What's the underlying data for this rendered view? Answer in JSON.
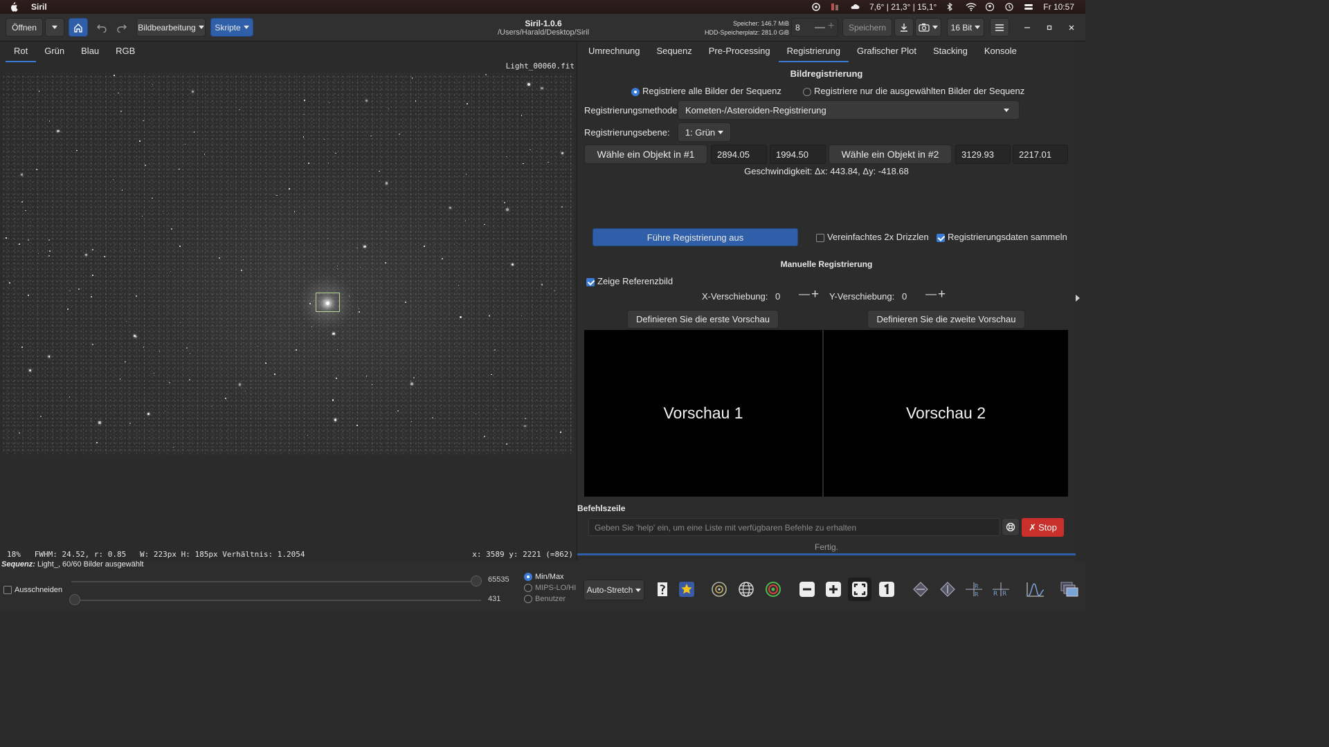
{
  "menubar": {
    "app_name": "Siril",
    "weather": "7,6° | 21,3° | 15,1°",
    "clock": "Fr 10:57"
  },
  "header": {
    "open_label": "Öffnen",
    "image_processing_label": "Bildbearbeitung",
    "scripts_label": "Skripte",
    "title": "Siril-1.0.6",
    "path": "/Users/Harald/Desktop/Siril",
    "memory": "Speicher: 146.7 MiB",
    "disk": "HDD-Speicherplatz: 281.0 GiB",
    "threads": "8",
    "save_label": "Speichern",
    "bitdepth": "16 Bit"
  },
  "left": {
    "tabs": [
      "Rot",
      "Grün",
      "Blau",
      "RGB"
    ],
    "filename": "Light_00060.fit",
    "status_left": "18%   FWHM: 24.52, r: 0.85   W: 223px H: 185px Verhältnis: 1.2054",
    "status_right": "x: 3589 y: 2221 (=862)"
  },
  "right": {
    "tabs": [
      "Umrechnung",
      "Sequenz",
      "Pre-Processing",
      "Registrierung",
      "Grafischer Plot",
      "Stacking",
      "Konsole"
    ],
    "section_title": "Bildregistrierung",
    "radio_all": "Registriere alle Bilder der Sequenz",
    "radio_selected": "Registriere nur die ausgewählten Bilder der Sequenz",
    "method_label": "Registrierungsmethode:",
    "method_value": "Kometen-/Asteroiden-Registrierung",
    "layer_label": "Registrierungsebene:",
    "layer_value": "1: Grün",
    "pick1_label": "Wähle ein Objekt in #1",
    "pick1_x": "2894.05",
    "pick1_y": "1994.50",
    "pick2_label": "Wähle ein Objekt in #2",
    "pick2_x": "3129.93",
    "pick2_y": "2217.01",
    "velocity": "Geschwindigkeit: Δx: 443.84, Δy: -418.68",
    "run_label": "Führe Registrierung aus",
    "drizzle_label": "Vereinfachtes 2x Drizzlen",
    "collect_label": "Registrierungsdaten sammeln",
    "manual_title": "Manuelle Registrierung",
    "show_ref_label": "Zeige Referenzbild",
    "xshift_label": "X-Verschiebung:",
    "xshift_value": "0",
    "yshift_label": "Y-Verschiebung:",
    "yshift_value": "0",
    "preview1_button": "Definieren Sie die erste Vorschau",
    "preview2_button": "Definieren Sie die zweite Vorschau",
    "preview1_label": "Vorschau 1",
    "preview2_label": "Vorschau 2",
    "cmd_title": "Befehlszeile",
    "cmd_placeholder": "Geben Sie 'help' ein, um eine Liste mit verfügbaren Befehle zu erhalten",
    "stop_label": "Stop",
    "status": "Fertig."
  },
  "bottom": {
    "sequence_prefix": "Sequenz:",
    "sequence_text": " Light_, 60/60 Bilder ausgewählt",
    "crop_label": "Ausschneiden",
    "max_value": "65535",
    "min_value": "431",
    "mode_minmax": "Min/Max",
    "mode_mips": "MIPS-LO/HI",
    "mode_user": "Benutzer",
    "stretch_label": "Auto-Stretch"
  }
}
